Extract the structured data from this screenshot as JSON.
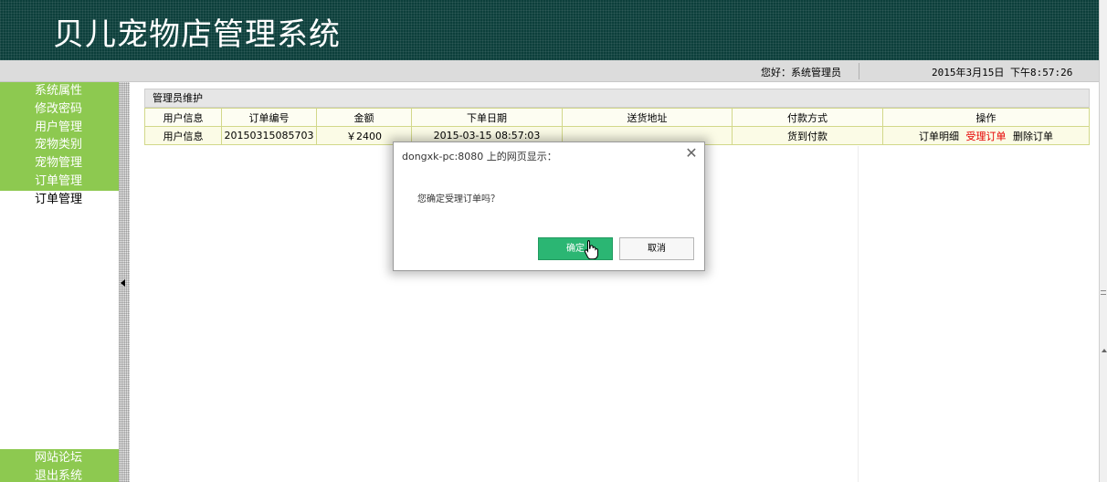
{
  "header": {
    "title": "贝儿宠物店管理系统"
  },
  "statusbar": {
    "greeting": "您好：系统管理员",
    "datetime": "2015年3月15日 下午8:57:26"
  },
  "sidebar": {
    "items": [
      {
        "label": "系统属性"
      },
      {
        "label": "修改密码"
      },
      {
        "label": "用户管理"
      },
      {
        "label": "宠物类别"
      },
      {
        "label": "宠物管理"
      },
      {
        "label": "订单管理"
      },
      {
        "label": "订单管理"
      }
    ],
    "bottom_items": [
      {
        "label": "网站论坛"
      },
      {
        "label": "退出系统"
      }
    ]
  },
  "panel": {
    "title": "管理员维护"
  },
  "table": {
    "headers": [
      "用户信息",
      "订单编号",
      "金额",
      "下单日期",
      "送货地址",
      "付款方式",
      "操作"
    ],
    "rows": [
      {
        "user_info": "用户信息",
        "order_no": "20150315085703",
        "amount": "￥2400",
        "date": "2015-03-15 08:57:03",
        "address": "",
        "payment": "货到付款",
        "op_detail": "订单明细",
        "op_accept": "受理订单",
        "op_delete": "删除订单"
      }
    ]
  },
  "dialog": {
    "title": "dongxk-pc:8080 上的网页显示：",
    "message": "您确定受理订单吗？",
    "ok_label": "确定",
    "cancel_label": "取消"
  },
  "colors": {
    "banner": "#0c3f3b",
    "menu": "#8dc950",
    "ok_button": "#2bb673",
    "link_red": "#e60000"
  }
}
